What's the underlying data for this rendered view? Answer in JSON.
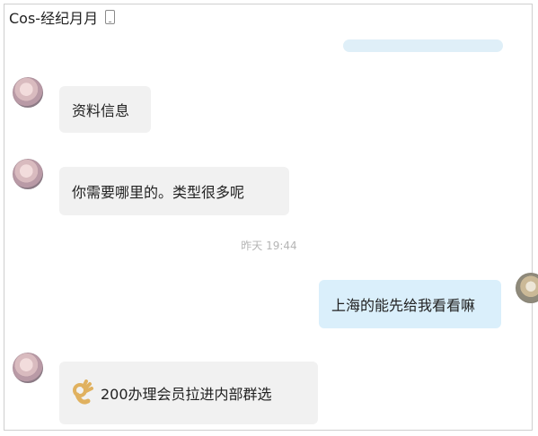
{
  "header": {
    "title": "Cos-经纪月月",
    "device_icon": "phone-icon"
  },
  "messages": [
    {
      "side": "in",
      "text": "资料信息"
    },
    {
      "side": "in",
      "text": "你需要哪里的。类型很多呢"
    },
    {
      "side": "out",
      "text": "上海的能先给我看看嘛"
    },
    {
      "side": "in",
      "icon": "ok-hand-emoji",
      "text": "200办理会员拉进内部群选"
    }
  ],
  "timestamp": "昨天 19:44",
  "colors": {
    "incoming_bubble": "#f1f1f1",
    "outgoing_bubble": "#daeffb"
  }
}
